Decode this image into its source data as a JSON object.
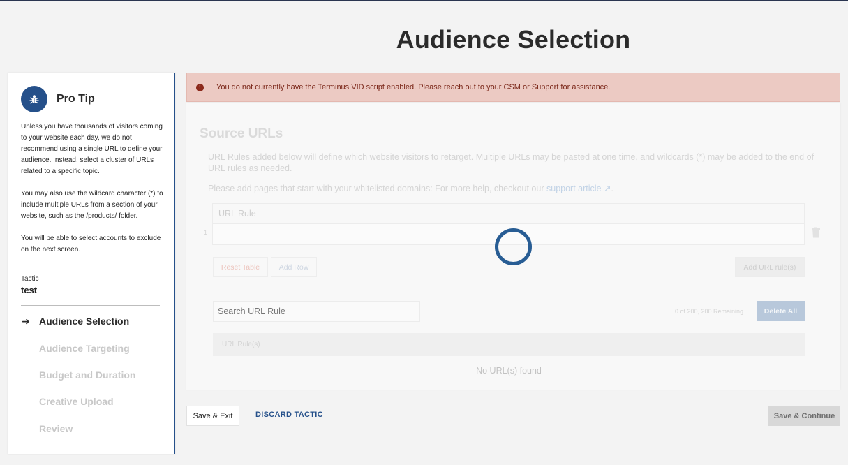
{
  "page": {
    "title": "Audience Selection"
  },
  "sidebar": {
    "tip_title": "Pro Tip",
    "tip_paragraphs": [
      "Unless you have thousands of visitors coming to your website each day, we do not recommend using a single URL to define your audience. Instead, select a cluster of URLs related to a specific topic.",
      "You may also use the wildcard character (*) to include multiple URLs from a section of your website, such as the /products/ folder.",
      "You will be able to select accounts to exclude on the next screen."
    ],
    "tactic_label": "Tactic",
    "tactic_value": "test",
    "steps": [
      {
        "label": "Audience Selection",
        "active": true
      },
      {
        "label": "Audience Targeting",
        "active": false
      },
      {
        "label": "Budget and Duration",
        "active": false
      },
      {
        "label": "Creative Upload",
        "active": false
      },
      {
        "label": "Review",
        "active": false
      }
    ]
  },
  "alert": {
    "text": "You do not currently have the Terminus VID script enabled. Please reach out to your CSM or Support for assistance.",
    "icon": "!"
  },
  "source_urls": {
    "title": "Source URLs",
    "description": "URL Rules added below will define which website visitors to retarget. Multiple URLs may be pasted at one time, and wildcards (*) may be added to the end of URL rules as needed.",
    "help_prefix": "Please add pages that start with your whitelisted domains: For more help, checkout our",
    "help_link": "support article",
    "help_suffix": ".",
    "grid_header": "URL Rule",
    "row_number": "1",
    "reset_label": "Reset Table",
    "add_row_label": "Add Row",
    "add_url_label": "Add URL rule(s)",
    "search_placeholder": "Search URL Rule",
    "remaining": "0 of 200, 200 Remaining",
    "delete_all_label": "Delete All",
    "list_header": "URL Rule(s)",
    "empty_text": "No URL(s) found"
  },
  "footer": {
    "save_exit": "Save & Exit",
    "discard": "DISCARD TACTIC",
    "save_continue": "Save & Continue"
  },
  "colors": {
    "accent": "#25508a",
    "alert_bg": "#eccac3",
    "alert_text": "#7a2618",
    "spinner": "#285d94"
  }
}
